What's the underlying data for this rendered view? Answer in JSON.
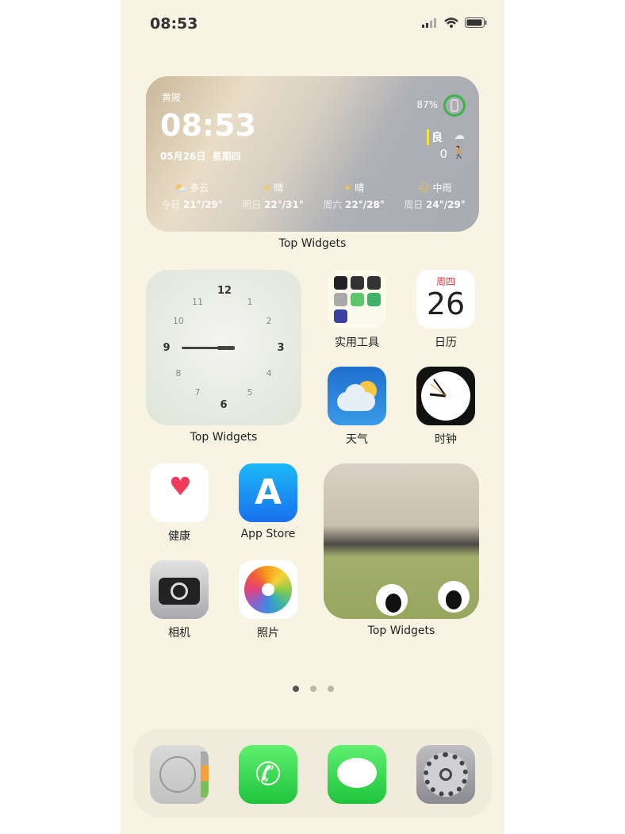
{
  "status_bar": {
    "time": "08:53"
  },
  "weather_widget": {
    "location": "黄陂",
    "time": "08:53",
    "date": "05月26日  星期四",
    "battery": "87%",
    "aqi": "良",
    "steps": "0",
    "forecast": [
      {
        "cond": "多云",
        "day": "今日",
        "temp": "21°/29°",
        "icon": "partly-cloudy"
      },
      {
        "cond": "晴",
        "day": "明日",
        "temp": "22°/31°",
        "icon": "sunny"
      },
      {
        "cond": "晴",
        "day": "周六",
        "temp": "22°/28°",
        "icon": "sunny"
      },
      {
        "cond": "中雨",
        "day": "周日",
        "temp": "24°/29°",
        "icon": "rain"
      }
    ],
    "label": "Top Widgets"
  },
  "clock_widget": {
    "label": "Top Widgets",
    "numerals": [
      "12",
      "1",
      "2",
      "3",
      "4",
      "5",
      "6",
      "7",
      "8",
      "9",
      "10",
      "11"
    ]
  },
  "apps": {
    "utilities": "实用工具",
    "calendar": "日历",
    "calendar_weekday": "周四",
    "calendar_day": "26",
    "weather": "天气",
    "clock": "时钟",
    "health": "健康",
    "app_store": "App Store",
    "camera": "相机",
    "photos": "照片"
  },
  "photo_widget": {
    "label": "Top Widgets"
  },
  "page_dots": {
    "count": 3,
    "active": 0
  },
  "dock": [
    "contacts",
    "phone",
    "messages",
    "settings"
  ]
}
